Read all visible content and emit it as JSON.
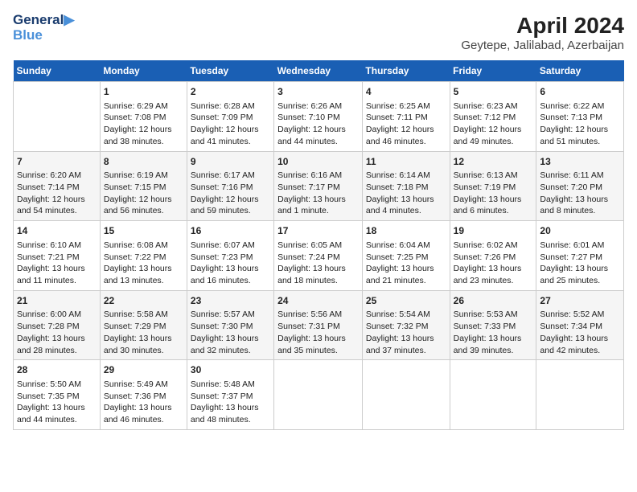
{
  "header": {
    "logo_line1": "General",
    "logo_line2": "Blue",
    "title": "April 2024",
    "subtitle": "Geytepe, Jalilabad, Azerbaijan"
  },
  "calendar": {
    "days_of_week": [
      "Sunday",
      "Monday",
      "Tuesday",
      "Wednesday",
      "Thursday",
      "Friday",
      "Saturday"
    ],
    "weeks": [
      [
        {
          "day": "",
          "sunrise": "",
          "sunset": "",
          "daylight": ""
        },
        {
          "day": "1",
          "sunrise": "Sunrise: 6:29 AM",
          "sunset": "Sunset: 7:08 PM",
          "daylight": "Daylight: 12 hours and 38 minutes."
        },
        {
          "day": "2",
          "sunrise": "Sunrise: 6:28 AM",
          "sunset": "Sunset: 7:09 PM",
          "daylight": "Daylight: 12 hours and 41 minutes."
        },
        {
          "day": "3",
          "sunrise": "Sunrise: 6:26 AM",
          "sunset": "Sunset: 7:10 PM",
          "daylight": "Daylight: 12 hours and 44 minutes."
        },
        {
          "day": "4",
          "sunrise": "Sunrise: 6:25 AM",
          "sunset": "Sunset: 7:11 PM",
          "daylight": "Daylight: 12 hours and 46 minutes."
        },
        {
          "day": "5",
          "sunrise": "Sunrise: 6:23 AM",
          "sunset": "Sunset: 7:12 PM",
          "daylight": "Daylight: 12 hours and 49 minutes."
        },
        {
          "day": "6",
          "sunrise": "Sunrise: 6:22 AM",
          "sunset": "Sunset: 7:13 PM",
          "daylight": "Daylight: 12 hours and 51 minutes."
        }
      ],
      [
        {
          "day": "7",
          "sunrise": "Sunrise: 6:20 AM",
          "sunset": "Sunset: 7:14 PM",
          "daylight": "Daylight: 12 hours and 54 minutes."
        },
        {
          "day": "8",
          "sunrise": "Sunrise: 6:19 AM",
          "sunset": "Sunset: 7:15 PM",
          "daylight": "Daylight: 12 hours and 56 minutes."
        },
        {
          "day": "9",
          "sunrise": "Sunrise: 6:17 AM",
          "sunset": "Sunset: 7:16 PM",
          "daylight": "Daylight: 12 hours and 59 minutes."
        },
        {
          "day": "10",
          "sunrise": "Sunrise: 6:16 AM",
          "sunset": "Sunset: 7:17 PM",
          "daylight": "Daylight: 13 hours and 1 minute."
        },
        {
          "day": "11",
          "sunrise": "Sunrise: 6:14 AM",
          "sunset": "Sunset: 7:18 PM",
          "daylight": "Daylight: 13 hours and 4 minutes."
        },
        {
          "day": "12",
          "sunrise": "Sunrise: 6:13 AM",
          "sunset": "Sunset: 7:19 PM",
          "daylight": "Daylight: 13 hours and 6 minutes."
        },
        {
          "day": "13",
          "sunrise": "Sunrise: 6:11 AM",
          "sunset": "Sunset: 7:20 PM",
          "daylight": "Daylight: 13 hours and 8 minutes."
        }
      ],
      [
        {
          "day": "14",
          "sunrise": "Sunrise: 6:10 AM",
          "sunset": "Sunset: 7:21 PM",
          "daylight": "Daylight: 13 hours and 11 minutes."
        },
        {
          "day": "15",
          "sunrise": "Sunrise: 6:08 AM",
          "sunset": "Sunset: 7:22 PM",
          "daylight": "Daylight: 13 hours and 13 minutes."
        },
        {
          "day": "16",
          "sunrise": "Sunrise: 6:07 AM",
          "sunset": "Sunset: 7:23 PM",
          "daylight": "Daylight: 13 hours and 16 minutes."
        },
        {
          "day": "17",
          "sunrise": "Sunrise: 6:05 AM",
          "sunset": "Sunset: 7:24 PM",
          "daylight": "Daylight: 13 hours and 18 minutes."
        },
        {
          "day": "18",
          "sunrise": "Sunrise: 6:04 AM",
          "sunset": "Sunset: 7:25 PM",
          "daylight": "Daylight: 13 hours and 21 minutes."
        },
        {
          "day": "19",
          "sunrise": "Sunrise: 6:02 AM",
          "sunset": "Sunset: 7:26 PM",
          "daylight": "Daylight: 13 hours and 23 minutes."
        },
        {
          "day": "20",
          "sunrise": "Sunrise: 6:01 AM",
          "sunset": "Sunset: 7:27 PM",
          "daylight": "Daylight: 13 hours and 25 minutes."
        }
      ],
      [
        {
          "day": "21",
          "sunrise": "Sunrise: 6:00 AM",
          "sunset": "Sunset: 7:28 PM",
          "daylight": "Daylight: 13 hours and 28 minutes."
        },
        {
          "day": "22",
          "sunrise": "Sunrise: 5:58 AM",
          "sunset": "Sunset: 7:29 PM",
          "daylight": "Daylight: 13 hours and 30 minutes."
        },
        {
          "day": "23",
          "sunrise": "Sunrise: 5:57 AM",
          "sunset": "Sunset: 7:30 PM",
          "daylight": "Daylight: 13 hours and 32 minutes."
        },
        {
          "day": "24",
          "sunrise": "Sunrise: 5:56 AM",
          "sunset": "Sunset: 7:31 PM",
          "daylight": "Daylight: 13 hours and 35 minutes."
        },
        {
          "day": "25",
          "sunrise": "Sunrise: 5:54 AM",
          "sunset": "Sunset: 7:32 PM",
          "daylight": "Daylight: 13 hours and 37 minutes."
        },
        {
          "day": "26",
          "sunrise": "Sunrise: 5:53 AM",
          "sunset": "Sunset: 7:33 PM",
          "daylight": "Daylight: 13 hours and 39 minutes."
        },
        {
          "day": "27",
          "sunrise": "Sunrise: 5:52 AM",
          "sunset": "Sunset: 7:34 PM",
          "daylight": "Daylight: 13 hours and 42 minutes."
        }
      ],
      [
        {
          "day": "28",
          "sunrise": "Sunrise: 5:50 AM",
          "sunset": "Sunset: 7:35 PM",
          "daylight": "Daylight: 13 hours and 44 minutes."
        },
        {
          "day": "29",
          "sunrise": "Sunrise: 5:49 AM",
          "sunset": "Sunset: 7:36 PM",
          "daylight": "Daylight: 13 hours and 46 minutes."
        },
        {
          "day": "30",
          "sunrise": "Sunrise: 5:48 AM",
          "sunset": "Sunset: 7:37 PM",
          "daylight": "Daylight: 13 hours and 48 minutes."
        },
        {
          "day": "",
          "sunrise": "",
          "sunset": "",
          "daylight": ""
        },
        {
          "day": "",
          "sunrise": "",
          "sunset": "",
          "daylight": ""
        },
        {
          "day": "",
          "sunrise": "",
          "sunset": "",
          "daylight": ""
        },
        {
          "day": "",
          "sunrise": "",
          "sunset": "",
          "daylight": ""
        }
      ]
    ]
  }
}
